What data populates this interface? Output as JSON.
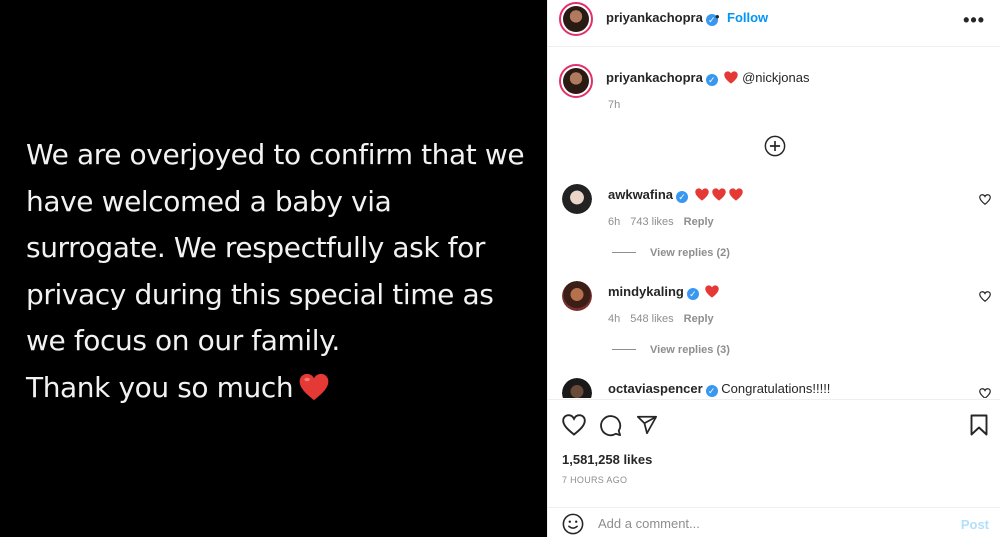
{
  "post_image": {
    "lines": [
      "We are overjoyed to confirm that we",
      "have welcomed a baby via",
      "surrogate. We respectfully ask for",
      "privacy during this special time as",
      "we focus on our family.",
      "Thank you so much"
    ],
    "heart_icon": "red-heart-emoji"
  },
  "header": {
    "username": "priyankachopra",
    "separator": "•",
    "follow_label": "Follow",
    "more_label": "•••"
  },
  "caption": {
    "username": "priyankachopra",
    "mention": "@nickjonas",
    "time": "7h"
  },
  "comments": [
    {
      "username": "awkwafina",
      "text": "",
      "emoji_count": 3,
      "time": "6h",
      "likes": "743 likes",
      "reply": "Reply",
      "view_replies": "View replies (2)"
    },
    {
      "username": "mindykaling",
      "text": "",
      "emoji_count": 1,
      "time": "4h",
      "likes": "548 likes",
      "reply": "Reply",
      "view_replies": "View replies (3)"
    },
    {
      "username": "octaviaspencer",
      "text": "Congratulations!!!!!"
    }
  ],
  "footer": {
    "likes": "1,581,258 likes",
    "time": "7 HOURS AGO",
    "comment_placeholder": "Add a comment...",
    "post_label": "Post"
  },
  "colors": {
    "follow": "#0095f6",
    "verified": "#3897f0",
    "heart": "#ed4956",
    "post_disabled": "#b2dffc"
  }
}
